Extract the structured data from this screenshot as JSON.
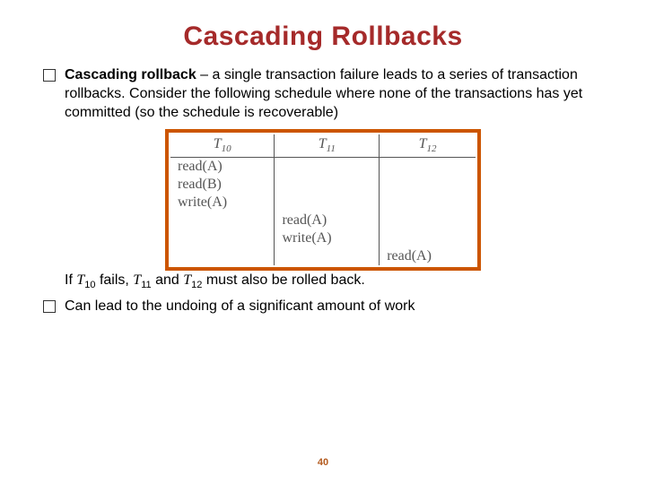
{
  "title": "Cascading Rollbacks",
  "bullet1": {
    "bold": "Cascading rollback",
    "rest": " – a single transaction failure leads to a series of transaction rollbacks.  Consider the following schedule where none of the transactions has yet committed (so the schedule is recoverable)"
  },
  "table": {
    "headers": {
      "h1_T": "T",
      "h1_n": "10",
      "h2_T": "T",
      "h2_n": "11",
      "h3_T": "T",
      "h3_n": "12"
    },
    "cells": {
      "r1c1": "read(A)",
      "r2c1": "read(B)",
      "r3c1": "write(A)",
      "r4c2": "read(A)",
      "r5c2": "write(A)",
      "r6c3": "read(A)"
    }
  },
  "followup": {
    "p1": "If ",
    "t10T": "T",
    "t10n": "10",
    "p2": " fails, ",
    "t11T": "T",
    "t11n": "11",
    "p3": " and ",
    "t12T": "T",
    "t12n": "12",
    "p4": " must also be rolled back."
  },
  "bullet2": "Can lead to the undoing of a significant amount of work",
  "page": "40"
}
